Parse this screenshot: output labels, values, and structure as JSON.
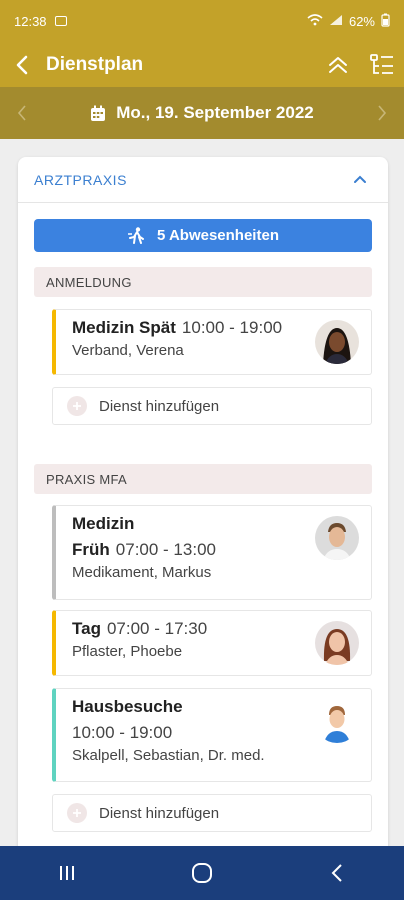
{
  "status": {
    "time": "12:38",
    "battery": "62%"
  },
  "appbar": {
    "title": "Dienstplan"
  },
  "date": {
    "label": "Mo., 19. September 2022"
  },
  "card": {
    "title": "ARZTPRAXIS"
  },
  "absences": {
    "label": "5 Abwesenheiten"
  },
  "sections": [
    {
      "title": "ANMELDUNG",
      "shifts": [
        {
          "name": "Medizin Spät",
          "time": "10:00 - 19:00",
          "person": "Verband, Verena",
          "color": "#f5b800"
        }
      ],
      "add_label": "Dienst hinzufügen"
    },
    {
      "title": "PRAXIS MFA",
      "shifts": [
        {
          "name": "Medizin",
          "name2": "Früh",
          "time": "07:00 - 13:00",
          "person": "Medikament, Markus",
          "color": "#bdbdbd"
        },
        {
          "name": "Tag",
          "time": "07:00 - 17:30",
          "person": "Pflaster, Phoebe",
          "color": "#f5b800"
        },
        {
          "name": "Hausbesuche",
          "time": "10:00 - 19:00",
          "person": "Skalpell, Sebastian, Dr. med.",
          "color": "#5fd3c0"
        }
      ],
      "add_label": "Dienst hinzufügen"
    }
  ],
  "icons": {
    "back": "chevron-left-icon",
    "collapse_all": "double-chevron-up-icon",
    "list_settings": "list-tree-icon",
    "calendar": "calendar-icon",
    "absence": "person-walking-icon",
    "add": "plus-icon",
    "section_collapse": "chevron-up-icon"
  },
  "colors": {
    "brand": "#c3a229",
    "date_bar": "#a38b2e",
    "accent_blue": "#3b82e0",
    "nav_bar": "#1b3e7c"
  }
}
